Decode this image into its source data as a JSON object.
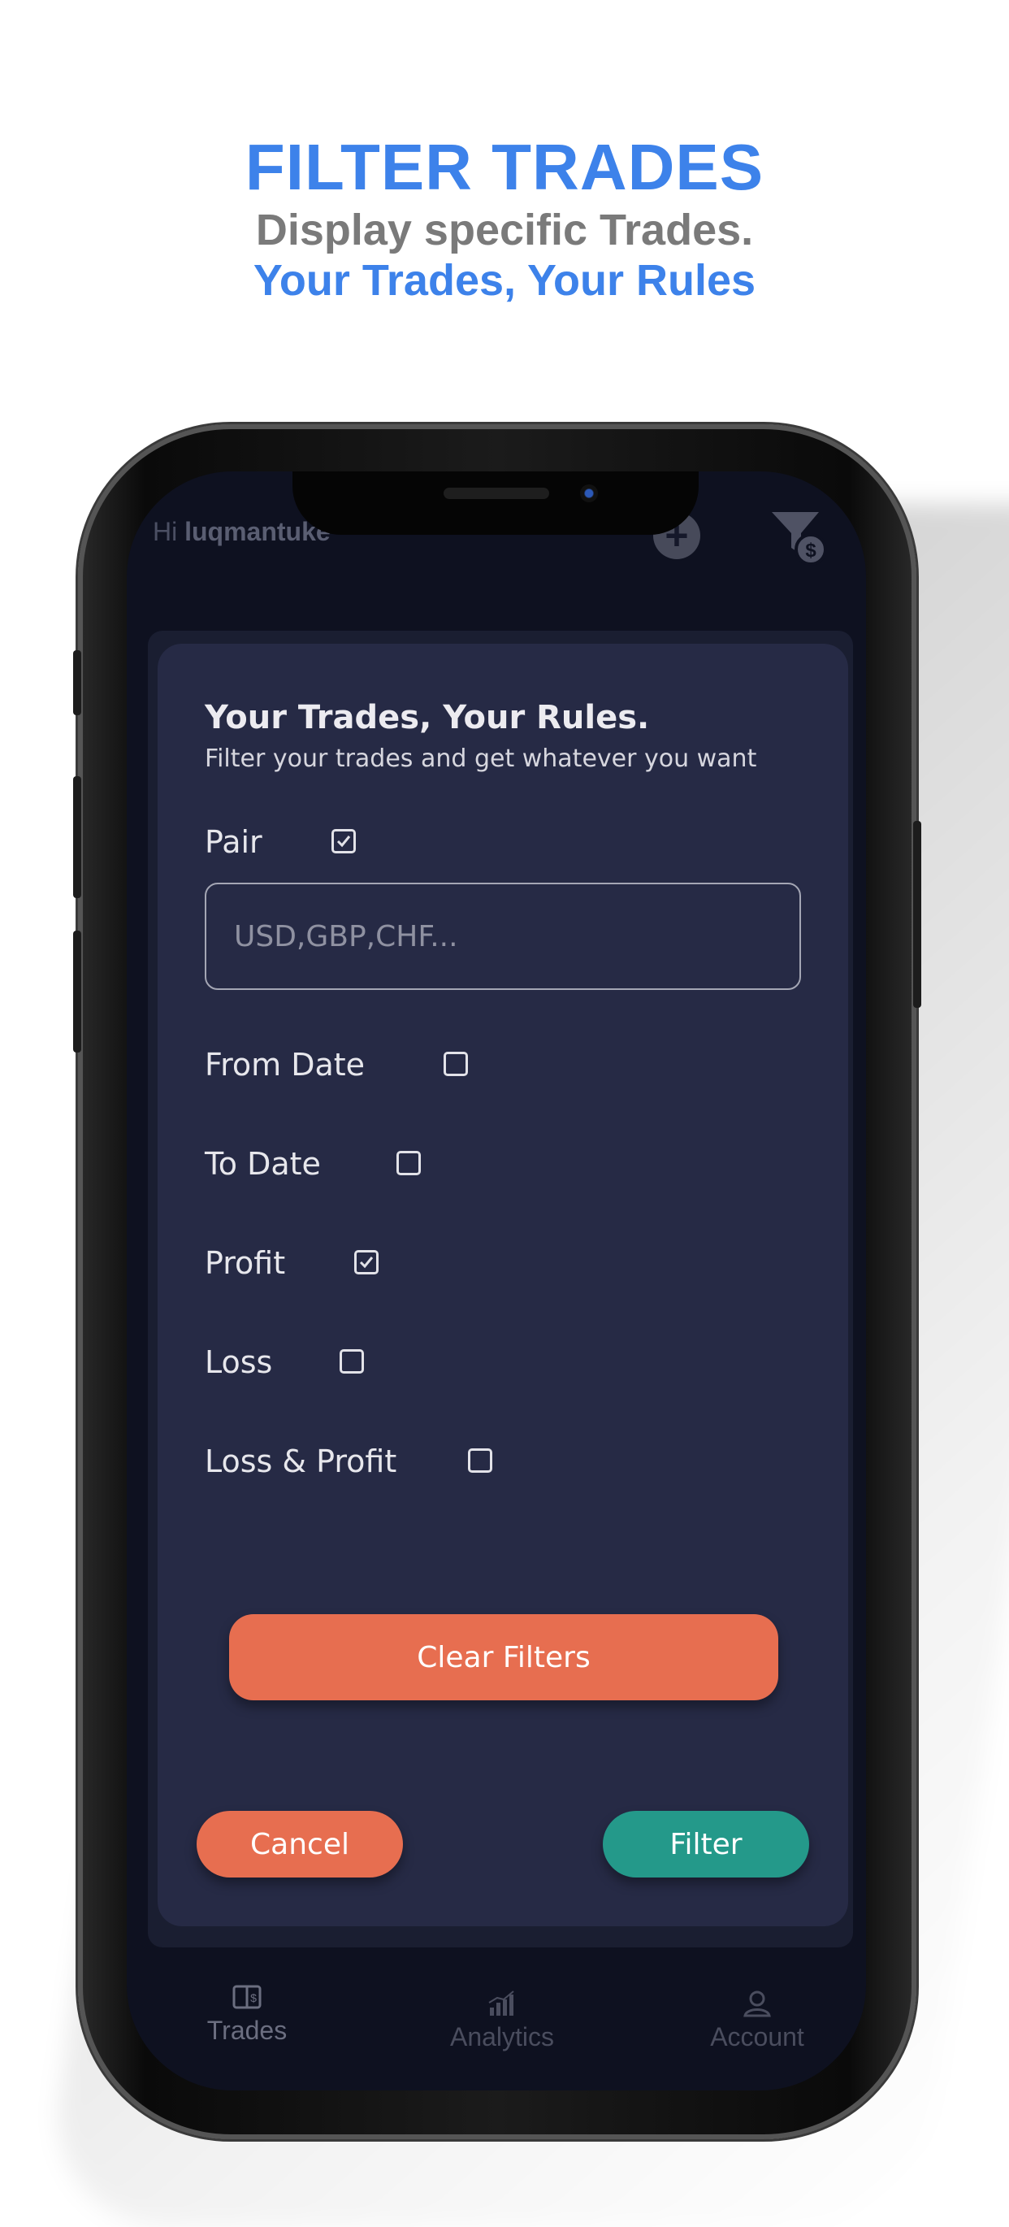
{
  "promo": {
    "title": "FILTER TRADES",
    "subtitle_line1": "Display specific Trades.",
    "subtitle_line2": "Your Trades, Your Rules"
  },
  "app_header": {
    "greeting_prefix": "Hi ",
    "username": "luqmantuke",
    "add_icon": "plus-icon",
    "filter_icon": "funnel-dollar-icon"
  },
  "filter_dialog": {
    "title": "Your Trades, Your Rules.",
    "subtitle": "Filter your trades and get whatever you want",
    "pair": {
      "label": "Pair",
      "checked": true,
      "input_placeholder": "USD,GBP,CHF...",
      "input_value": ""
    },
    "options": [
      {
        "label": "From Date",
        "checked": false
      },
      {
        "label": "To Date",
        "checked": false
      },
      {
        "label": "Profit",
        "checked": true
      },
      {
        "label": "Loss",
        "checked": false
      },
      {
        "label": "Loss & Profit",
        "checked": false
      }
    ],
    "clear_button": "Clear Filters",
    "cancel_button": "Cancel",
    "filter_button": "Filter"
  },
  "bottom_nav": [
    {
      "label": "Trades",
      "icon": "wallet-icon",
      "active": true
    },
    {
      "label": "Analytics",
      "icon": "bar-chart-icon",
      "active": false
    },
    {
      "label": "Account",
      "icon": "user-icon",
      "active": false
    }
  ],
  "colors": {
    "promo_blue": "#3d82ea",
    "dialog_bg": "#262a45",
    "accent_orange": "#e76e50",
    "accent_teal": "#24998a"
  }
}
